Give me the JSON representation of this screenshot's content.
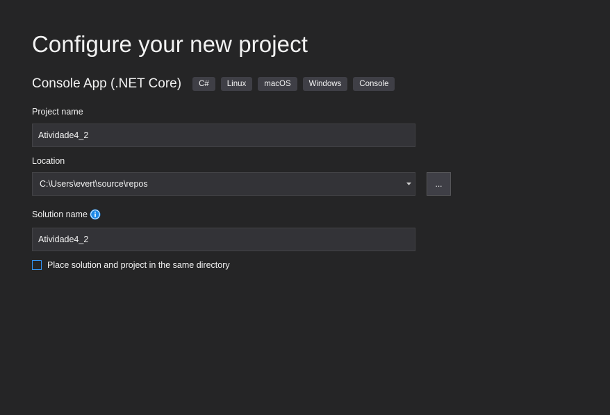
{
  "header": {
    "title": "Configure your new project"
  },
  "template": {
    "name": "Console App (.NET Core)",
    "tags": [
      "C#",
      "Linux",
      "macOS",
      "Windows",
      "Console"
    ]
  },
  "form": {
    "project_name": {
      "label": "Project name",
      "value": "Atividade4_2"
    },
    "location": {
      "label": "Location",
      "value": "C:\\Users\\evert\\source\\repos",
      "browse_label": "..."
    },
    "solution_name": {
      "label": "Solution name",
      "value": "Atividade4_2",
      "info_icon": "info-icon"
    },
    "same_directory": {
      "label": "Place solution and project in the same directory",
      "checked": false
    }
  },
  "colors": {
    "background": "#252526",
    "input_background": "#333337",
    "tag_background": "#3f3f46",
    "accent": "#3399ff",
    "text": "#f1f1f1"
  }
}
